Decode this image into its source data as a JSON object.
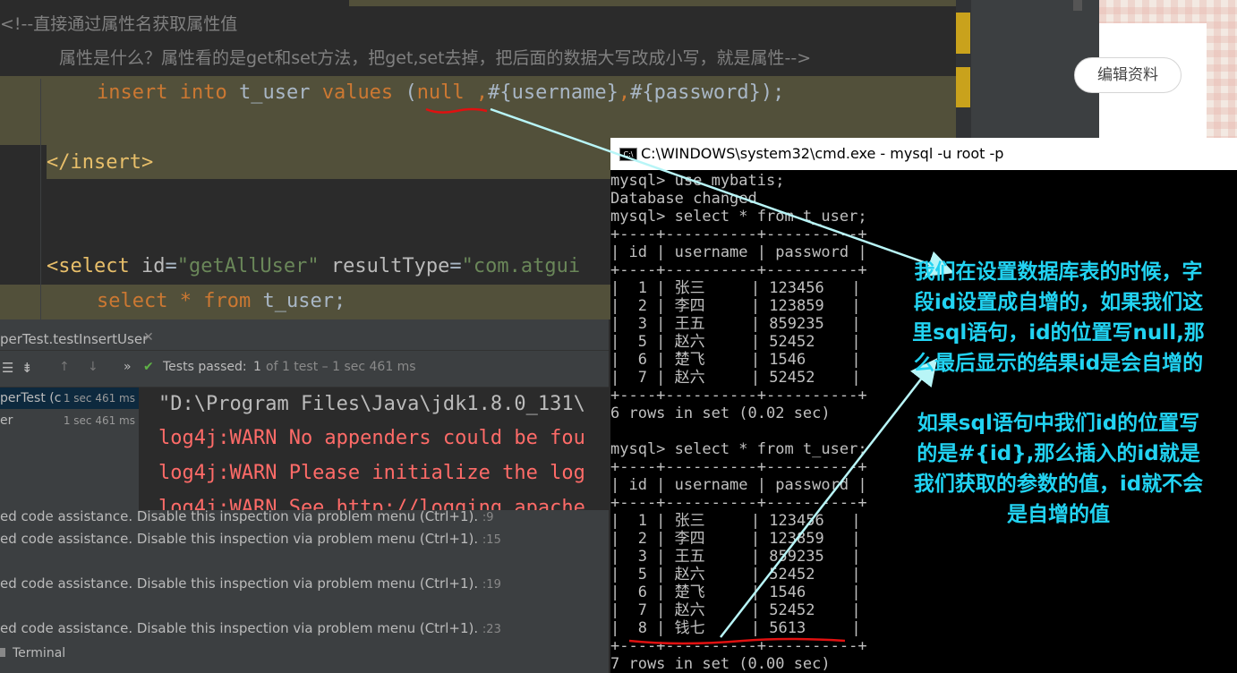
{
  "editor": {
    "comment_line1": "<!--直接通过属性名获取属性值",
    "comment_line2": "属性是什么？属性看的是get和set方法，把get,set去掉，把后面的数据大写改成小写，就是属性-->",
    "insert_kw1": "insert",
    "insert_kw2": "into",
    "insert_table": "t_user",
    "insert_kw3": "values",
    "insert_paren": "(",
    "insert_null": "null",
    "insert_comma1": " ,",
    "insert_p1": "#{username}",
    "insert_comma2": ",",
    "insert_p2": "#{password}",
    "insert_end": ");",
    "close_insert": "</insert>",
    "select_open": "<select",
    "select_attr1": "id",
    "select_val1": "\"getAllUser\"",
    "select_attr2": "resultType",
    "select_val2": "\"com.atgui",
    "select_kw1": "select",
    "select_star": "*",
    "select_kw2": "from",
    "select_table": "t_user;",
    "colors": {
      "keyword": "#cc7832",
      "tag": "#e8bf6a",
      "string": "#6a8759",
      "comment": "#808080",
      "highlight": "#52503a"
    }
  },
  "browser": {
    "edit_profile": "编辑资料"
  },
  "run": {
    "tab_label": "perTest.testInsertUser",
    "tests_passed_label": "Tests passed:",
    "tests_passed_count": "1",
    "tests_passed_rest": "of 1 test – 1 sec 461 ms",
    "tree": [
      {
        "label": "perTest (c",
        "time": "1 sec 461 ms"
      },
      {
        "label": "er",
        "time": "1 sec 461 ms"
      }
    ],
    "console": [
      "\"D:\\Program Files\\Java\\jdk1.8.0_131\\",
      "log4j:WARN No appenders could be fou",
      "log4j:WARN Please initialize the log",
      "log4j:WARN See http://logging.apache"
    ]
  },
  "problems": [
    {
      "text": "ed code assistance. Disable this inspection via problem menu (Ctrl+1).",
      "line": ":9"
    },
    {
      "text": "ed code assistance. Disable this inspection via problem menu (Ctrl+1).",
      "line": ":15"
    },
    {
      "text": "ed code assistance. Disable this inspection via problem menu (Ctrl+1).",
      "line": ":19"
    },
    {
      "text": "ed code assistance. Disable this inspection via problem menu (Ctrl+1).",
      "line": ":23"
    }
  ],
  "terminal_label": "Terminal",
  "cmd": {
    "title": "C:\\WINDOWS\\system32\\cmd.exe - mysql  -u root -p",
    "icon_text": "C:\\",
    "lines1": [
      "mysql> use mybatis;",
      "Database changed",
      "mysql> select * from t_user;",
      "+----+----------+----------+",
      "| id | username | password |",
      "+----+----------+----------+",
      "|  1 | 张三     | 123456   |",
      "|  2 | 李四     | 123859   |",
      "|  3 | 王五     | 859235   |",
      "|  5 | 赵六     | 52452    |",
      "|  6 | 楚飞     | 1546     |",
      "|  7 | 赵六     | 52452    |",
      "+----+----------+----------+",
      "6 rows in set (0.02 sec)",
      "",
      "mysql> select * from t_user;",
      "+----+----------+----------+",
      "| id | username | password |",
      "+----+----------+----------+",
      "|  1 | 张三     | 123456   |",
      "|  2 | 李四     | 123859   |",
      "|  3 | 王五     | 859235   |",
      "|  5 | 赵六     | 52452    |",
      "|  6 | 楚飞     | 1546     |",
      "|  7 | 赵六     | 52452    |",
      "|  8 | 钱七     | 5613     |",
      "+----+----------+----------+",
      "7 rows in set (0.00 sec)"
    ]
  },
  "annotations": {
    "note1": "我们在设置数据库表的时候，字段id设置成自增的，如果我们这里sql语句，id的位置写null,那么最后显示的结果id是会自增的",
    "note2": "如果sql语句中我们id的位置写的是#{id},那么插入的id就是我们获取的参数的值，id就不会是自增的值",
    "color": "#22d3f2",
    "underline_color": "#e01010"
  }
}
